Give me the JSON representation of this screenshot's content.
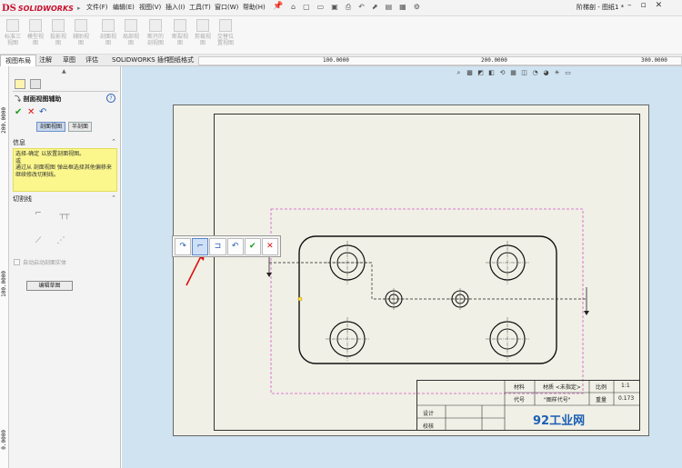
{
  "app": {
    "logo_prefix": "DS",
    "logo_name": "SOLIDWORKS",
    "doc_title": "阶梯剖 - 图纸1 *"
  },
  "menu": [
    {
      "label": "文件(F)"
    },
    {
      "label": "编辑(E)"
    },
    {
      "label": "视图(V)"
    },
    {
      "label": "插入(I)"
    },
    {
      "label": "工具(T)"
    },
    {
      "label": "窗口(W)"
    },
    {
      "label": "帮助(H)"
    }
  ],
  "ribbon": [
    {
      "label": "标准三视图"
    },
    {
      "label": "模型视图"
    },
    {
      "label": "投影视图"
    },
    {
      "label": "辅助视图"
    },
    {
      "label": "剖面视图"
    },
    {
      "label": "局部视图"
    },
    {
      "label": "断开的剖视图"
    },
    {
      "label": "断裂视图"
    },
    {
      "label": "剪裁视图"
    },
    {
      "label": "交替位置视图"
    }
  ],
  "tabs": [
    {
      "label": "视图布局",
      "active": true
    },
    {
      "label": "注解",
      "active": false
    },
    {
      "label": "草图",
      "active": false
    },
    {
      "label": "评估",
      "active": false
    },
    {
      "label": "SOLIDWORKS 插件",
      "active": false
    },
    {
      "label": "图纸格式",
      "active": false
    }
  ],
  "ruler_h": {
    "t1": "100.0000",
    "t2": "200.0000",
    "t3": "300.0000"
  },
  "ruler_v": {
    "t1": "200.0000",
    "t2": "100.0000",
    "t3": "0.0000"
  },
  "property_manager": {
    "title": "剖面视图辅助",
    "help": "?",
    "segments": [
      "剖面视图",
      "半剖面"
    ],
    "info_header": "信息",
    "info_text": "选择-确定 以放置剖面视图。\n或\n通过从 剖面视图 弹出框选择其他偏移来继续修改切割线。",
    "cut_header": "切割线",
    "auto_check_label": "自动启动剖面实体",
    "edit_sketch_label": "编辑草图"
  },
  "title_block": {
    "material_label": "材料",
    "material_value": "材质 <未指定>",
    "scale_label": "比例",
    "scale_value": "1:1",
    "code_label": "代号",
    "code_value": "\"图样代号\"",
    "weight_label": "重量",
    "weight_value": "0.173",
    "design_label": "设计",
    "check_label": "校核"
  },
  "watermark": "92工业网",
  "colors": {
    "canvas_bg": "#cfe3f1",
    "info_bg": "#fbf78c",
    "accent_red": "#c8102e",
    "section_line": "#d455c7",
    "ok_green": "#1a9a1a"
  }
}
